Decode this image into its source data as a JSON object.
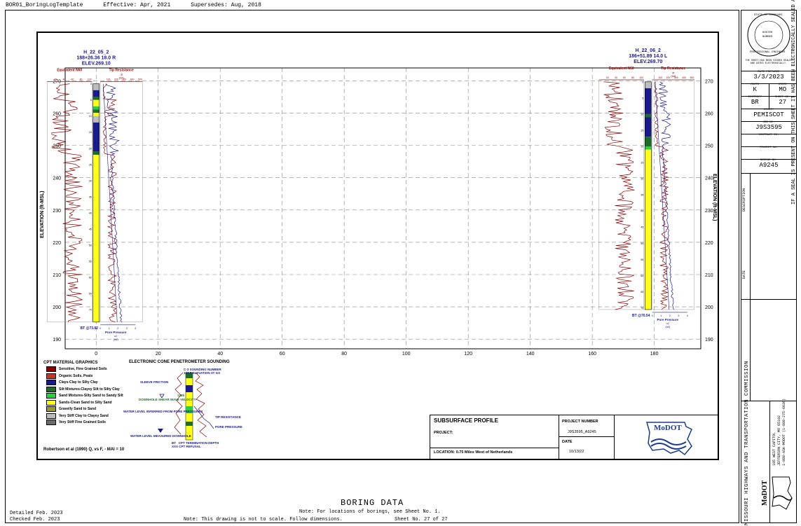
{
  "header": {
    "template": "BOR01_BoringLogTemplate",
    "effective": "Effective: Apr, 2021",
    "supersedes": "Supersedes: Aug, 2018"
  },
  "chart": {
    "y_axis_label": "ELEVATION (ft-MSL)",
    "y_ticks": [
      270,
      260,
      250,
      240,
      230,
      220,
      210,
      200,
      190
    ],
    "x_ticks": [
      0,
      20,
      40,
      60,
      80,
      100,
      120,
      140,
      160,
      180
    ],
    "x_tick_labels": [
      "0",
      "20",
      "40",
      "60",
      "80",
      "100",
      "120",
      "140",
      "160",
      "180"
    ]
  },
  "chart_data": {
    "type": "line",
    "title": "",
    "xlabel": "",
    "ylabel": "ELEVATION (ft-MSL)",
    "xlim": [
      -10,
      195
    ],
    "ylim": [
      187,
      274
    ],
    "grid": true,
    "soundings": [
      {
        "name": "H_22_05_2",
        "station": "188+26.36 18.0 R",
        "elevation_text": "ELEV.269.10",
        "x_position": 0,
        "ground_elevation": 269.1,
        "termination_label": "BT @73.82",
        "termination_depth": 73.82,
        "depth_ticks": [
          "0",
          "5",
          "10",
          "15",
          "20",
          "25",
          "30",
          "35",
          "40",
          "45",
          "50",
          "55",
          "60",
          "65",
          "70"
        ],
        "n60_ticks": [
          "20",
          "40",
          "60",
          "80",
          "100"
        ],
        "qt_ticks": [
          "100",
          "200",
          "300",
          "400",
          "500"
        ],
        "pore_ticks": [
          "0",
          "1",
          "2",
          "3",
          "4"
        ],
        "soil_layers": [
          {
            "top_depth": 0,
            "bottom_depth": 2,
            "material": "Very Stiff Clay to Clayey Sand"
          },
          {
            "top_depth": 2,
            "bottom_depth": 4,
            "material": "Clays-Clay to Silty Clay"
          },
          {
            "top_depth": 4,
            "bottom_depth": 5,
            "material": "Silt Mixtures-Clayey Silt to Silty Clay"
          },
          {
            "top_depth": 5,
            "bottom_depth": 7,
            "material": "Sands-Clean Sand to Silty Sand"
          },
          {
            "top_depth": 7,
            "bottom_depth": 8,
            "material": "Sand Mixtures-Silty Sand to Sandy Silt"
          },
          {
            "top_depth": 8,
            "bottom_depth": 9,
            "material": "Silt Mixtures-Clayey Silt to Silty Clay"
          },
          {
            "top_depth": 9,
            "bottom_depth": 10,
            "material": "Sands-Clean Sand to Silty Sand"
          },
          {
            "top_depth": 10,
            "bottom_depth": 12,
            "material": "Very Stiff Clay to Clayey Sand"
          },
          {
            "top_depth": 12,
            "bottom_depth": 21,
            "material": "Clays-Clay to Silty Clay"
          },
          {
            "top_depth": 21,
            "bottom_depth": 22,
            "material": "Silt Mixtures-Clayey Silt to Silty Clay"
          },
          {
            "top_depth": 22,
            "bottom_depth": 73.82,
            "material": "Sands-Clean Sand to Silty Sand"
          }
        ]
      },
      {
        "name": "H_22_06_2",
        "station": "186+51.89 14.0 L",
        "elevation_text": "ELEV.269.70",
        "x_position": 178,
        "ground_elevation": 269.7,
        "termination_label": "BT @70.54",
        "termination_depth": 70.54,
        "depth_ticks": [
          "0",
          "5",
          "10",
          "15",
          "20",
          "25",
          "30",
          "35",
          "40",
          "45",
          "50",
          "55",
          "60",
          "65",
          "70"
        ],
        "n60_ticks": [
          "20",
          "40",
          "60",
          "80",
          "100"
        ],
        "qt_ticks": [
          "100",
          "200",
          "300",
          "400",
          "500"
        ],
        "pore_ticks": [
          "0",
          "1",
          "2",
          "3",
          "4"
        ],
        "soil_layers": [
          {
            "top_depth": 0,
            "bottom_depth": 2,
            "material": "Very Stiff Clay to Clayey Sand"
          },
          {
            "top_depth": 2,
            "bottom_depth": 10,
            "material": "Clays-Clay to Silty Clay"
          },
          {
            "top_depth": 10,
            "bottom_depth": 11,
            "material": "Silt Mixtures-Clayey Silt to Silty Clay"
          },
          {
            "top_depth": 11,
            "bottom_depth": 17,
            "material": "Clays-Clay to Silty Clay"
          },
          {
            "top_depth": 17,
            "bottom_depth": 20,
            "material": "Silt Mixtures-Clayey Silt to Silty Clay"
          },
          {
            "top_depth": 20,
            "bottom_depth": 21,
            "material": "Sand Mixtures-Silty Sand to Sandy Silt"
          },
          {
            "top_depth": 21,
            "bottom_depth": 70.54,
            "material": "Sands-Clean Sand to Silty Sand"
          }
        ]
      }
    ],
    "curve_labels": {
      "equivalent_n60": "Equivalent N60",
      "tip_resistance": "Tip Resistance",
      "qt": "qt",
      "tsf": "(tsf)",
      "pore_pressure": "Pore Pressure",
      "u2": "u2"
    }
  },
  "legend": {
    "title": "CPT MATERIAL GRAPHICS",
    "items": [
      {
        "label": "Sensitive, Fine Grained Soils",
        "color": "#8b0000"
      },
      {
        "label": "Organic Soils, Peats",
        "color": "#c0392b"
      },
      {
        "label": "Clays-Clay to Silty Clay",
        "color": "#1a1a8c"
      },
      {
        "label": "Silt Mixtures-Clayey Silt to Silty Clay",
        "color": "#1f6b2a"
      },
      {
        "label": "Sand Mixtures-Silty Sand to Sandy Silt",
        "color": "#2ecc40"
      },
      {
        "label": "Sands-Clean Sand to Silty Sand",
        "color": "#ffff1a"
      },
      {
        "label": "Gravelly Sand to Sand",
        "color": "#9a9a2e"
      },
      {
        "label": "Very Stiff Clay to Clayey Sand",
        "color": "#bdbdbd"
      },
      {
        "label": "Very Stiff Fine Grained Soils",
        "color": "#6b6b6b"
      }
    ],
    "method": "Robertson et al (1990) Q, vs F, - MAI = 10"
  },
  "ecps": {
    "title": "ELECTRONIC CONE PENETROMETER SOUNDING",
    "sounding_code": "C-3",
    "sounding_number": "SOUNDING NUMBER",
    "elev_value": "123.8",
    "elev_label": "ELEVATION AT GS",
    "sleeve_friction": "SLEEVE FRICTION",
    "shear_value": "1285",
    "shear_label": "DOWNHOLE SHEAR WAVE VELOCITY",
    "water_inferred": "WATER LEVEL INFERRED FROM PORE PRESSURES",
    "tip_resistance": "TIP RESISTANCE",
    "pore_pressure": "PORE PRESSURE",
    "water_measured": "WATER LEVEL MEASURED DOWNHOLE",
    "bt_code": "BT",
    "bt_label": "CPT TERMINATION DEPTH",
    "xxx_code": "XXX",
    "xxx_label": "CPT REFUSAL"
  },
  "info": {
    "title": "SUBSURFACE PROFILE",
    "project_label": "PROJECT:",
    "location_label": "LOCATION:",
    "location_value": "0.75 Miles West of Netherlands",
    "project_number_label": "PROJECT NUMBER",
    "project_number_value": "J9S3595_A9245",
    "date_label": "DATE",
    "date_value": "10/13/22",
    "logo_text": "MoDOT"
  },
  "titleblock": {
    "seal_lines": [
      "STATE OF MISSOURI",
      "KOSTER",
      "NUMBER",
      "PROFESSIONAL ENGINEER"
    ],
    "seal_note": "THE SHEET HAS BEEN SIGNED SEALED AND DATED ELECTRONICALLY.",
    "date_prepared_label": "DATE PREPARED",
    "date_prepared": "3/3/2023",
    "route_label": "ROUTE",
    "route": "K",
    "state_label": "STATE",
    "state": "MO",
    "district_label": "DISTRICT",
    "district": "BR",
    "sheet_no_label": "SHEET NO.",
    "sheet_no": "27",
    "county_label": "COUNTY",
    "county": "PEMISCOT",
    "job_no_label": "JOB NO.",
    "job_no": "J9S3595",
    "contract_label": "CONTRACT ID.",
    "project_no_label": "PROJECT NO.",
    "bridge_no_label": "BRIDGE NO.",
    "bridge_no": "A9245",
    "description_label": "DESCRIPTION",
    "date_col_label": "DATE",
    "commission": "MISSOURI HIGHWAYS AND TRANSPORTATION COMMISSION",
    "address1": "105 WEST CAPITOL",
    "address2": "JEFFERSON CITY, MO 65102",
    "address3": "1-888-ASK-MODOT (1-888-275-6636)",
    "logo_text": "MoDOT",
    "side_note": "IF A SEAL IS PRESENT ON THIS SHEET IT HAS BEEN ELECTRONICALLY SEALED AND DATED."
  },
  "footer": {
    "detailed": "Detailed Feb. 2023",
    "checked": "Checked  Feb. 2023",
    "title": "BORING DATA",
    "note1": "Note: For locations of borings, see Sheet No. 1.",
    "note2": "Note: This drawing is not to scale. Follow dimensions.",
    "sheet": "Sheet No. 27 of 27"
  }
}
